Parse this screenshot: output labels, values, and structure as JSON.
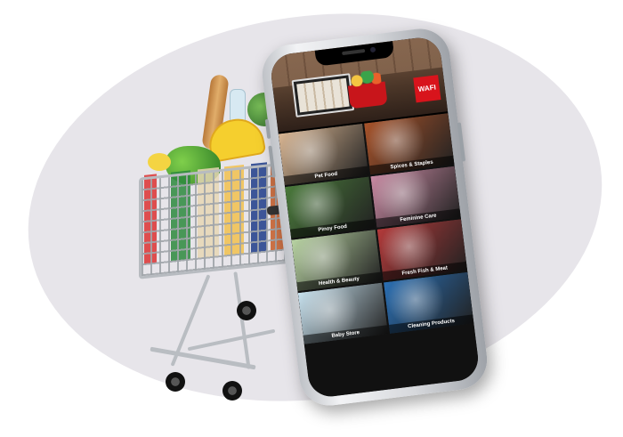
{
  "app": {
    "logo_text": "WAFI",
    "categories": [
      {
        "label": "Pet Food",
        "image": "dog-and-pet-bowl-icon",
        "color": "#d9b693"
      },
      {
        "label": "Spices & Staples",
        "image": "spice-bowls-icon",
        "color": "#a8532a"
      },
      {
        "label": "Pinoy Food",
        "image": "packaged-goods-icon",
        "color": "#4a7a3b"
      },
      {
        "label": "Feminine Care",
        "image": "pink-packages-icon",
        "color": "#c98aa3"
      },
      {
        "label": "Health & Beauty",
        "image": "bottles-icon",
        "color": "#b9d4a3"
      },
      {
        "label": "Fresh Fish & Meat",
        "image": "raw-meat-icon",
        "color": "#b33a3a"
      },
      {
        "label": "Baby Store",
        "image": "baby-icon",
        "color": "#c8e2ef"
      },
      {
        "label": "Cleaning Products",
        "image": "detergent-bottles-icon",
        "color": "#2a6fb4"
      }
    ]
  },
  "colors": {
    "background_blob": "#e7e5ea",
    "brand_red": "#d8141c"
  }
}
